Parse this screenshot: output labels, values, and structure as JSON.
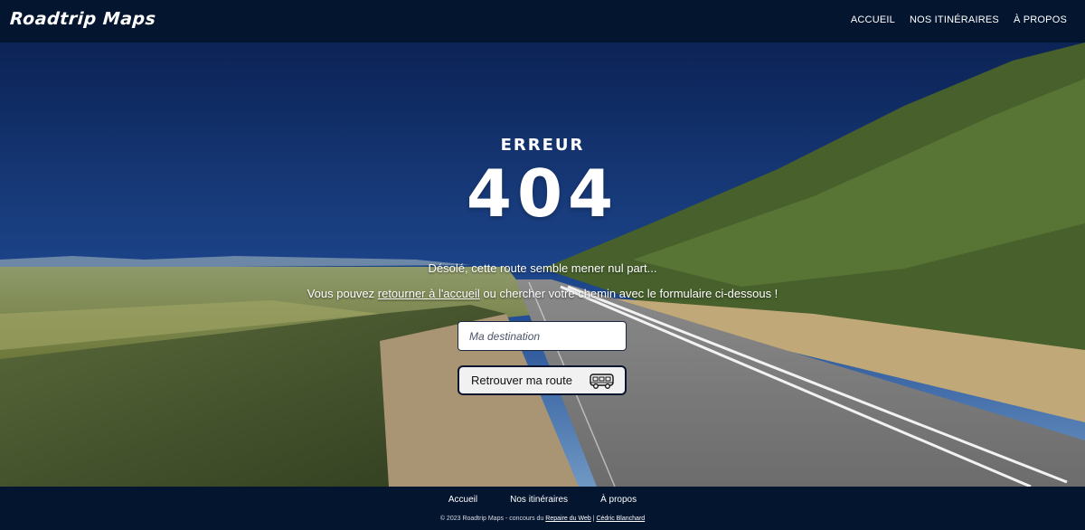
{
  "header": {
    "logo": "Roadtrip Maps",
    "nav": [
      "ACCUEIL",
      "NOS ITINÉRAIRES",
      "À PROPOS"
    ]
  },
  "hero": {
    "label": "ERREUR",
    "code": "404",
    "sorry": "Désolé, cette route semble mener nul part...",
    "hint_before": "Vous pouvez ",
    "hint_link": "retourner à l'accueil",
    "hint_after": " ou chercher votre chemin avec le formulaire ci-dessous !",
    "input_placeholder": "Ma destination",
    "button_label": "Retrouver ma route",
    "button_icon": "van-icon"
  },
  "footer": {
    "nav": [
      "Accueil",
      "Nos itinéraires",
      "À propos"
    ],
    "copyright_prefix": "© 2023 Roadtrip Maps - concours du ",
    "copyright_link1": "Repaire du Web",
    "copyright_sep": " | ",
    "copyright_link2": "Cédric Blanchard"
  },
  "colors": {
    "header_bg": "#04152f",
    "footer_bg": "#04152f",
    "text": "#ffffff"
  }
}
